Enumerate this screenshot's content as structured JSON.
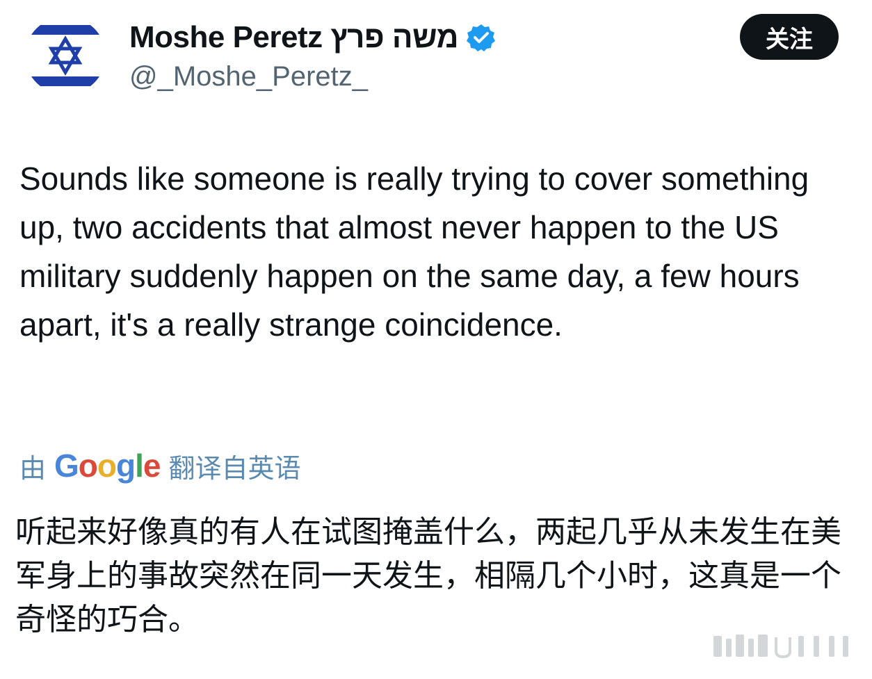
{
  "profile": {
    "display_name": "Moshe Peretz משה פרץ",
    "handle": "@_Moshe_Peretz_",
    "avatar": "israel-flag-avatar",
    "verified_color": "#1d9bf0"
  },
  "follow_button": {
    "label": "关注"
  },
  "tweet": {
    "text": "Sounds like someone is really trying to cover something up, two accidents that almost never happen to the US military suddenly happen on the same day, a few hours apart, it's a really strange coincidence."
  },
  "translation": {
    "prefix": "由",
    "provider": "Google",
    "suffix": "翻译自英语",
    "text": "听起来好像真的有人在试图掩盖什么，两起几乎从未发生在美军身上的事故突然在同一天发生，相隔几个小时，这真是一个奇怪的巧合。"
  },
  "colors": {
    "flag_blue": "#1f3ea8",
    "accent_link": "#5b8ab0",
    "button_bg": "#0f1419"
  }
}
